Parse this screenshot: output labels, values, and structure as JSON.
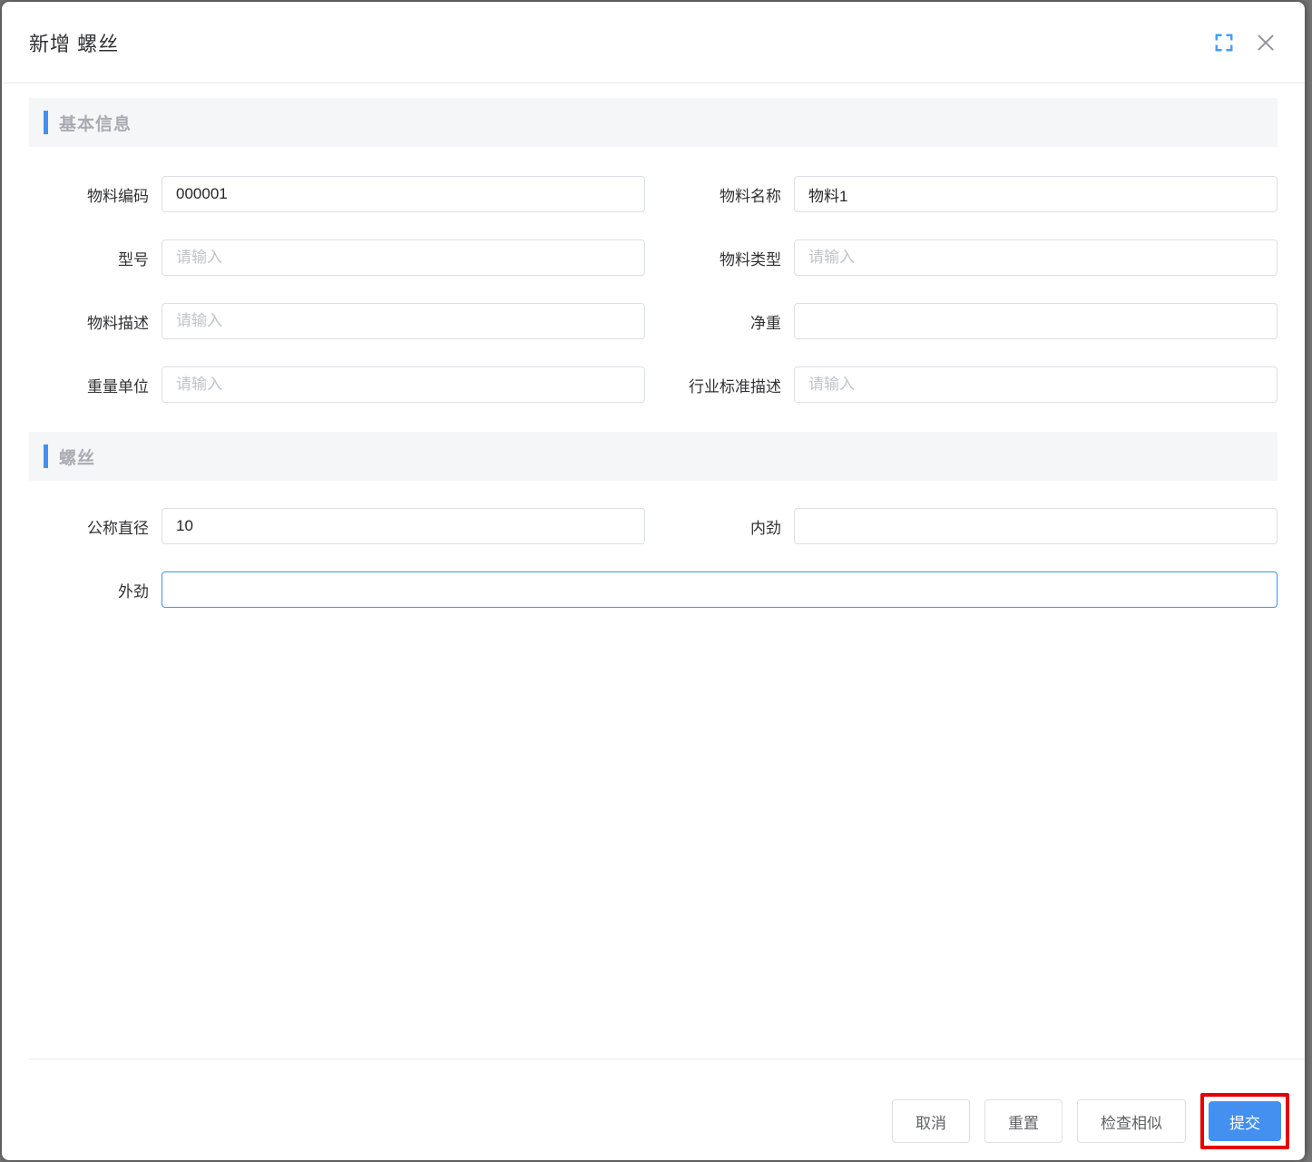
{
  "dialog": {
    "title": "新增 螺丝"
  },
  "sections": {
    "basic": "基本信息",
    "screw": "螺丝"
  },
  "fields": {
    "material_code": {
      "label": "物料编码",
      "value": "000001",
      "placeholder": ""
    },
    "material_name": {
      "label": "物料名称",
      "value": "物料1",
      "placeholder": ""
    },
    "model": {
      "label": "型号",
      "value": "",
      "placeholder": "请输入"
    },
    "material_type": {
      "label": "物料类型",
      "value": "",
      "placeholder": "请输入"
    },
    "material_desc": {
      "label": "物料描述",
      "value": "",
      "placeholder": "请输入"
    },
    "net_weight": {
      "label": "净重",
      "value": "",
      "placeholder": ""
    },
    "weight_unit": {
      "label": "重量单位",
      "value": "",
      "placeholder": "请输入"
    },
    "industry_std_desc": {
      "label": "行业标准描述",
      "value": "",
      "placeholder": "请输入"
    },
    "nominal_diameter": {
      "label": "公称直径",
      "value": "10",
      "placeholder": ""
    },
    "inner_strength": {
      "label": "内劲",
      "value": "",
      "placeholder": ""
    },
    "outer_strength": {
      "label": "外劲",
      "value": "",
      "placeholder": ""
    }
  },
  "footer": {
    "cancel": "取消",
    "reset": "重置",
    "check_similar": "检查相似",
    "submit": "提交"
  },
  "colors": {
    "primary": "#4390F0",
    "annotation_red": "#E60000",
    "section_bg": "#F5F6F7",
    "section_text": "#A8ABB2",
    "input_border": "#DCDFE6",
    "placeholder": "#C0C4CC"
  }
}
